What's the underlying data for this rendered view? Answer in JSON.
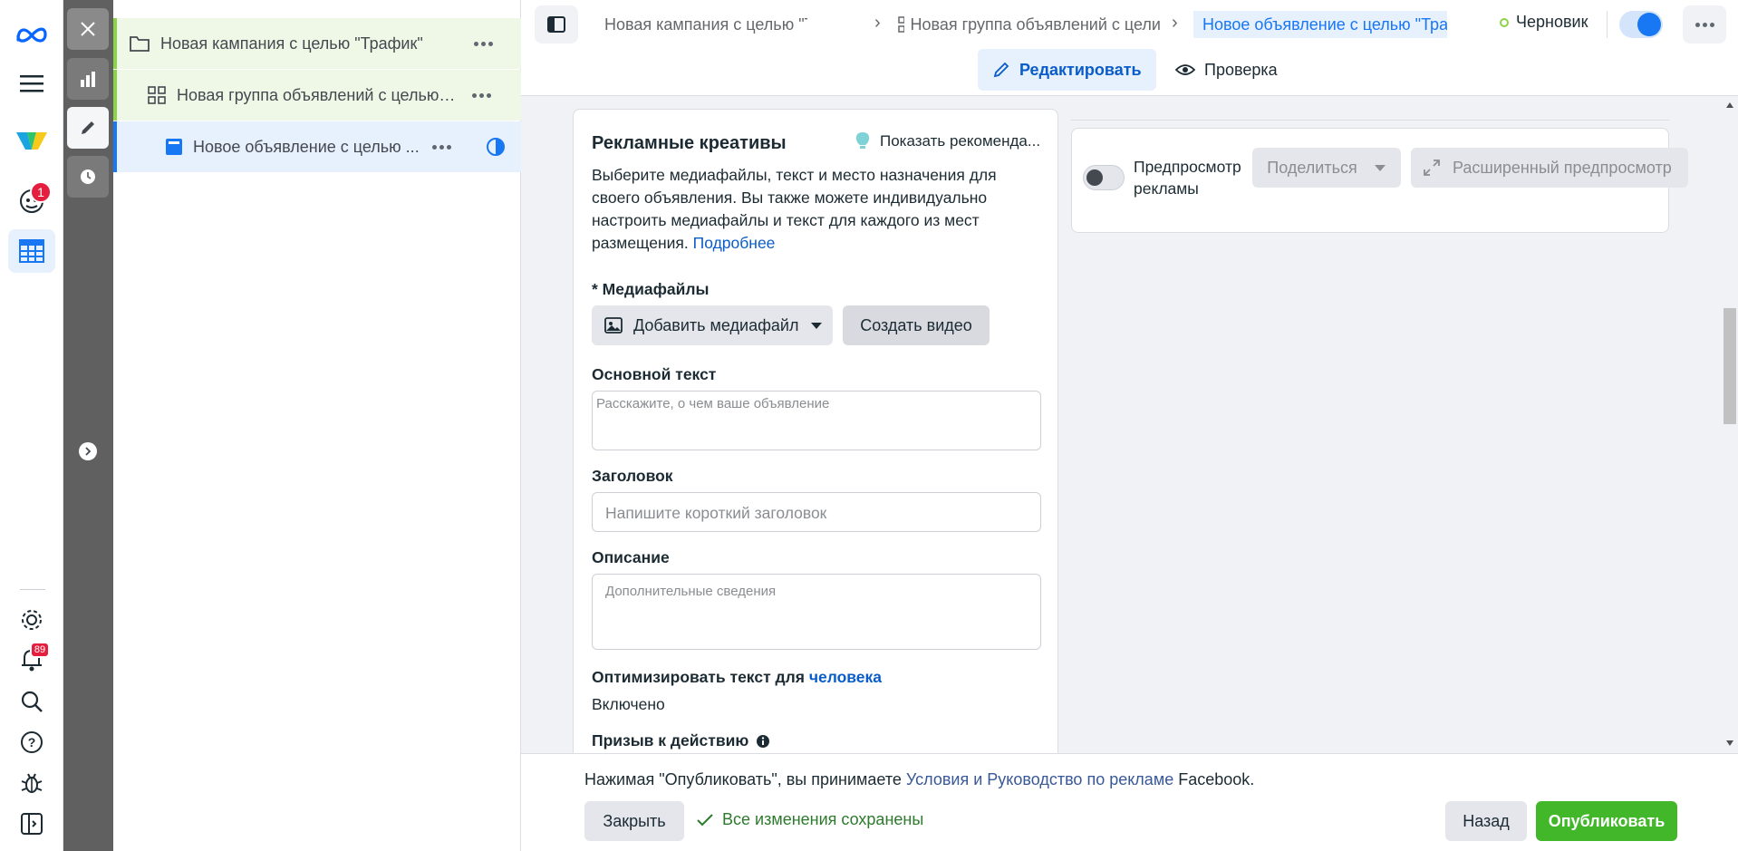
{
  "rail": {
    "notifications_count": "1",
    "alerts_count": "89"
  },
  "tree": {
    "campaign": "Новая кампания с целью \"Трафик\"",
    "adset": "Новая группа объявлений с целью \"...",
    "ad": "Новое объявление с целью ..."
  },
  "topbar": {
    "crumb_campaign": "Новая кампания с целью \"Трафи",
    "crumb_adset": "Новая группа объявлений с цели",
    "crumb_ad": "Новое объявление с целью \"Тра",
    "status": "Черновик",
    "edit_label": "Редактировать",
    "review_label": "Проверка"
  },
  "creatives": {
    "title": "Рекламные креативы",
    "reco_label": "Показать рекоменда...",
    "description": "Выберите медиафайлы, текст и место назначения для своего объявления. Вы также можете индивидуально настроить медиафайлы и текст для каждого из мест размещения.",
    "more_link": "Подробнее",
    "media_label": "* Медиафайлы",
    "add_media": "Добавить медиафайл",
    "create_video": "Создать видео",
    "primary_text_label": "Основной текст",
    "primary_text_placeholder": "Расскажите, о чем ваше объявление",
    "headline_label": "Заголовок",
    "headline_placeholder": "Напишите короткий заголовок",
    "description_label": "Описание",
    "description_placeholder": "Дополнительные сведения",
    "optimize_label": "Оптимизировать текст для",
    "optimize_link": "человека",
    "optimize_value": "Включено",
    "cta_label": "Призыв к действию"
  },
  "preview": {
    "toggle_label": "Предпросмотр рекламы",
    "share": "Поделиться",
    "advanced": "Расширенный предпросмотр"
  },
  "footer": {
    "terms_prefix": "Нажимая \"Опубликовать\", вы принимаете",
    "terms_link": "Условия и Руководство по рекламе",
    "terms_suffix": "Facebook.",
    "close": "Закрыть",
    "saved": "Все изменения сохранены",
    "back": "Назад",
    "publish": "Опубликовать"
  }
}
